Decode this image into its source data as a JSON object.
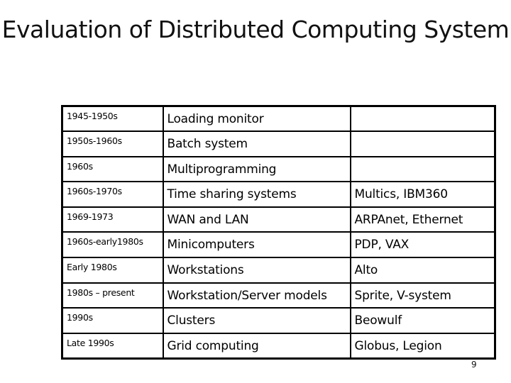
{
  "slide": {
    "title": "Evaluation of Distributed Computing System",
    "page_number": "9"
  },
  "table": {
    "rows": [
      {
        "era": "1945-1950s",
        "system": "Loading monitor",
        "examples": ""
      },
      {
        "era": "1950s-1960s",
        "system": "Batch system",
        "examples": ""
      },
      {
        "era": "1960s",
        "system": "Multiprogramming",
        "examples": ""
      },
      {
        "era": "1960s-1970s",
        "system": "Time sharing systems",
        "examples": "Multics, IBM360"
      },
      {
        "era": "1969-1973",
        "system": "WAN and LAN",
        "examples": "ARPAnet, Ethernet"
      },
      {
        "era": "1960s-early1980s",
        "system": "Minicomputers",
        "examples": "PDP, VAX"
      },
      {
        "era": "Early 1980s",
        "system": "Workstations",
        "examples": "Alto"
      },
      {
        "era": "1980s – present",
        "system": "Workstation/Server models",
        "examples": "Sprite, V-system"
      },
      {
        "era": "1990s",
        "system": "Clusters",
        "examples": "Beowulf"
      },
      {
        "era": "Late 1990s",
        "system": "Grid computing",
        "examples": "Globus, Legion"
      }
    ]
  }
}
